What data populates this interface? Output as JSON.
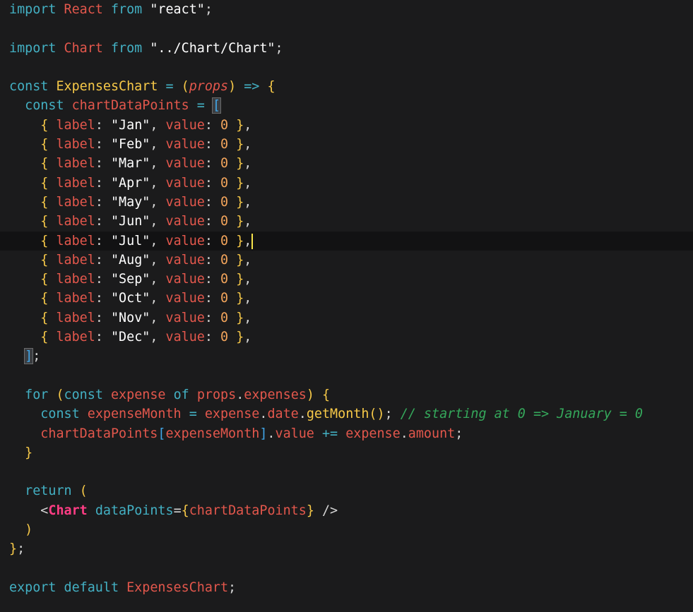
{
  "editor": {
    "lines": [
      {
        "tokens": [
          [
            "kw",
            "import"
          ],
          [
            "punc",
            " "
          ],
          [
            "cls",
            "React"
          ],
          [
            "punc",
            " "
          ],
          [
            "kw",
            "from"
          ],
          [
            "punc",
            " "
          ],
          [
            "str",
            "\"react\""
          ],
          [
            "punc",
            ";"
          ]
        ]
      },
      {
        "tokens": []
      },
      {
        "tokens": [
          [
            "kw",
            "import"
          ],
          [
            "punc",
            " "
          ],
          [
            "cls",
            "Chart"
          ],
          [
            "punc",
            " "
          ],
          [
            "kw",
            "from"
          ],
          [
            "punc",
            " "
          ],
          [
            "str",
            "\"../Chart/Chart\""
          ],
          [
            "punc",
            ";"
          ]
        ]
      },
      {
        "tokens": []
      },
      {
        "tokens": [
          [
            "kw",
            "const"
          ],
          [
            "punc",
            " "
          ],
          [
            "fn",
            "ExpensesChart"
          ],
          [
            "punc",
            " "
          ],
          [
            "op",
            "="
          ],
          [
            "punc",
            " "
          ],
          [
            "paren",
            "("
          ],
          [
            "param",
            "props"
          ],
          [
            "paren",
            ")"
          ],
          [
            "punc",
            " "
          ],
          [
            "op",
            "=>"
          ],
          [
            "punc",
            " "
          ],
          [
            "brace",
            "{"
          ]
        ]
      },
      {
        "tokens": [
          [
            "punc",
            "  "
          ],
          [
            "kw",
            "const"
          ],
          [
            "punc",
            " "
          ],
          [
            "var",
            "chartDataPoints"
          ],
          [
            "punc",
            " "
          ],
          [
            "op",
            "="
          ],
          [
            "punc",
            " "
          ],
          [
            "bracket",
            "["
          ]
        ]
      },
      {
        "tokens": [
          [
            "punc",
            "    "
          ],
          [
            "brace",
            "{"
          ],
          [
            "punc",
            " "
          ],
          [
            "prop",
            "label"
          ],
          [
            "punc",
            ": "
          ],
          [
            "str",
            "\"Jan\""
          ],
          [
            "punc",
            ", "
          ],
          [
            "prop",
            "value"
          ],
          [
            "punc",
            ": "
          ],
          [
            "num",
            "0"
          ],
          [
            "punc",
            " "
          ],
          [
            "brace",
            "}"
          ],
          [
            "punc",
            ","
          ]
        ]
      },
      {
        "tokens": [
          [
            "punc",
            "    "
          ],
          [
            "brace",
            "{"
          ],
          [
            "punc",
            " "
          ],
          [
            "prop",
            "label"
          ],
          [
            "punc",
            ": "
          ],
          [
            "str",
            "\"Feb\""
          ],
          [
            "punc",
            ", "
          ],
          [
            "prop",
            "value"
          ],
          [
            "punc",
            ": "
          ],
          [
            "num",
            "0"
          ],
          [
            "punc",
            " "
          ],
          [
            "brace",
            "}"
          ],
          [
            "punc",
            ","
          ]
        ]
      },
      {
        "tokens": [
          [
            "punc",
            "    "
          ],
          [
            "brace",
            "{"
          ],
          [
            "punc",
            " "
          ],
          [
            "prop",
            "label"
          ],
          [
            "punc",
            ": "
          ],
          [
            "str",
            "\"Mar\""
          ],
          [
            "punc",
            ", "
          ],
          [
            "prop",
            "value"
          ],
          [
            "punc",
            ": "
          ],
          [
            "num",
            "0"
          ],
          [
            "punc",
            " "
          ],
          [
            "brace",
            "}"
          ],
          [
            "punc",
            ","
          ]
        ]
      },
      {
        "tokens": [
          [
            "punc",
            "    "
          ],
          [
            "brace",
            "{"
          ],
          [
            "punc",
            " "
          ],
          [
            "prop",
            "label"
          ],
          [
            "punc",
            ": "
          ],
          [
            "str",
            "\"Apr\""
          ],
          [
            "punc",
            ", "
          ],
          [
            "prop",
            "value"
          ],
          [
            "punc",
            ": "
          ],
          [
            "num",
            "0"
          ],
          [
            "punc",
            " "
          ],
          [
            "brace",
            "}"
          ],
          [
            "punc",
            ","
          ]
        ]
      },
      {
        "tokens": [
          [
            "punc",
            "    "
          ],
          [
            "brace",
            "{"
          ],
          [
            "punc",
            " "
          ],
          [
            "prop",
            "label"
          ],
          [
            "punc",
            ": "
          ],
          [
            "str",
            "\"May\""
          ],
          [
            "punc",
            ", "
          ],
          [
            "prop",
            "value"
          ],
          [
            "punc",
            ": "
          ],
          [
            "num",
            "0"
          ],
          [
            "punc",
            " "
          ],
          [
            "brace",
            "}"
          ],
          [
            "punc",
            ","
          ]
        ]
      },
      {
        "tokens": [
          [
            "punc",
            "    "
          ],
          [
            "brace",
            "{"
          ],
          [
            "punc",
            " "
          ],
          [
            "prop",
            "label"
          ],
          [
            "punc",
            ": "
          ],
          [
            "str",
            "\"Jun\""
          ],
          [
            "punc",
            ", "
          ],
          [
            "prop",
            "value"
          ],
          [
            "punc",
            ": "
          ],
          [
            "num",
            "0"
          ],
          [
            "punc",
            " "
          ],
          [
            "brace",
            "}"
          ],
          [
            "punc",
            ","
          ]
        ]
      },
      {
        "tokens": [
          [
            "punc",
            "    "
          ],
          [
            "brace",
            "{"
          ],
          [
            "punc",
            " "
          ],
          [
            "prop",
            "label"
          ],
          [
            "punc",
            ": "
          ],
          [
            "str",
            "\"Jul\""
          ],
          [
            "punc",
            ", "
          ],
          [
            "prop",
            "value"
          ],
          [
            "punc",
            ": "
          ],
          [
            "num",
            "0"
          ],
          [
            "punc",
            " "
          ],
          [
            "brace",
            "}"
          ],
          [
            "punc",
            ","
          ]
        ],
        "current": true
      },
      {
        "tokens": [
          [
            "punc",
            "    "
          ],
          [
            "brace",
            "{"
          ],
          [
            "punc",
            " "
          ],
          [
            "prop",
            "label"
          ],
          [
            "punc",
            ": "
          ],
          [
            "str",
            "\"Aug\""
          ],
          [
            "punc",
            ", "
          ],
          [
            "prop",
            "value"
          ],
          [
            "punc",
            ": "
          ],
          [
            "num",
            "0"
          ],
          [
            "punc",
            " "
          ],
          [
            "brace",
            "}"
          ],
          [
            "punc",
            ","
          ]
        ]
      },
      {
        "tokens": [
          [
            "punc",
            "    "
          ],
          [
            "brace",
            "{"
          ],
          [
            "punc",
            " "
          ],
          [
            "prop",
            "label"
          ],
          [
            "punc",
            ": "
          ],
          [
            "str",
            "\"Sep\""
          ],
          [
            "punc",
            ", "
          ],
          [
            "prop",
            "value"
          ],
          [
            "punc",
            ": "
          ],
          [
            "num",
            "0"
          ],
          [
            "punc",
            " "
          ],
          [
            "brace",
            "}"
          ],
          [
            "punc",
            ","
          ]
        ]
      },
      {
        "tokens": [
          [
            "punc",
            "    "
          ],
          [
            "brace",
            "{"
          ],
          [
            "punc",
            " "
          ],
          [
            "prop",
            "label"
          ],
          [
            "punc",
            ": "
          ],
          [
            "str",
            "\"Oct\""
          ],
          [
            "punc",
            ", "
          ],
          [
            "prop",
            "value"
          ],
          [
            "punc",
            ": "
          ],
          [
            "num",
            "0"
          ],
          [
            "punc",
            " "
          ],
          [
            "brace",
            "}"
          ],
          [
            "punc",
            ","
          ]
        ]
      },
      {
        "tokens": [
          [
            "punc",
            "    "
          ],
          [
            "brace",
            "{"
          ],
          [
            "punc",
            " "
          ],
          [
            "prop",
            "label"
          ],
          [
            "punc",
            ": "
          ],
          [
            "str",
            "\"Nov\""
          ],
          [
            "punc",
            ", "
          ],
          [
            "prop",
            "value"
          ],
          [
            "punc",
            ": "
          ],
          [
            "num",
            "0"
          ],
          [
            "punc",
            " "
          ],
          [
            "brace",
            "}"
          ],
          [
            "punc",
            ","
          ]
        ]
      },
      {
        "tokens": [
          [
            "punc",
            "    "
          ],
          [
            "brace",
            "{"
          ],
          [
            "punc",
            " "
          ],
          [
            "prop",
            "label"
          ],
          [
            "punc",
            ": "
          ],
          [
            "str",
            "\"Dec\""
          ],
          [
            "punc",
            ", "
          ],
          [
            "prop",
            "value"
          ],
          [
            "punc",
            ": "
          ],
          [
            "num",
            "0"
          ],
          [
            "punc",
            " "
          ],
          [
            "brace",
            "}"
          ],
          [
            "punc",
            ","
          ]
        ]
      },
      {
        "tokens": [
          [
            "punc",
            "  "
          ],
          [
            "bracket",
            "]"
          ],
          [
            "punc",
            ";"
          ]
        ]
      },
      {
        "tokens": []
      },
      {
        "tokens": [
          [
            "punc",
            "  "
          ],
          [
            "kw",
            "for"
          ],
          [
            "punc",
            " "
          ],
          [
            "paren",
            "("
          ],
          [
            "kw",
            "const"
          ],
          [
            "punc",
            " "
          ],
          [
            "var",
            "expense"
          ],
          [
            "punc",
            " "
          ],
          [
            "kw",
            "of"
          ],
          [
            "punc",
            " "
          ],
          [
            "var",
            "props"
          ],
          [
            "punc",
            "."
          ],
          [
            "var",
            "expenses"
          ],
          [
            "paren",
            ")"
          ],
          [
            "punc",
            " "
          ],
          [
            "brace",
            "{"
          ]
        ]
      },
      {
        "tokens": [
          [
            "punc",
            "    "
          ],
          [
            "kw",
            "const"
          ],
          [
            "punc",
            " "
          ],
          [
            "var",
            "expenseMonth"
          ],
          [
            "punc",
            " "
          ],
          [
            "op",
            "="
          ],
          [
            "punc",
            " "
          ],
          [
            "var",
            "expense"
          ],
          [
            "punc",
            "."
          ],
          [
            "var",
            "date"
          ],
          [
            "punc",
            "."
          ],
          [
            "fn",
            "getMonth"
          ],
          [
            "paren",
            "()"
          ],
          [
            "punc",
            "; "
          ],
          [
            "cmt",
            "// starting at 0 => January = 0"
          ]
        ]
      },
      {
        "tokens": [
          [
            "punc",
            "    "
          ],
          [
            "var",
            "chartDataPoints"
          ],
          [
            "bracket",
            "["
          ],
          [
            "var",
            "expenseMonth"
          ],
          [
            "bracket",
            "]"
          ],
          [
            "punc",
            "."
          ],
          [
            "var",
            "value"
          ],
          [
            "punc",
            " "
          ],
          [
            "op",
            "+="
          ],
          [
            "punc",
            " "
          ],
          [
            "var",
            "expense"
          ],
          [
            "punc",
            "."
          ],
          [
            "var",
            "amount"
          ],
          [
            "punc",
            ";"
          ]
        ]
      },
      {
        "tokens": [
          [
            "punc",
            "  "
          ],
          [
            "brace",
            "}"
          ]
        ]
      },
      {
        "tokens": []
      },
      {
        "tokens": [
          [
            "punc",
            "  "
          ],
          [
            "kw",
            "return"
          ],
          [
            "punc",
            " "
          ],
          [
            "paren",
            "("
          ]
        ]
      },
      {
        "tokens": [
          [
            "punc",
            "    "
          ],
          [
            "punc",
            "<"
          ],
          [
            "tag",
            "Chart"
          ],
          [
            "punc",
            " "
          ],
          [
            "attr",
            "dataPoints"
          ],
          [
            "punc",
            "="
          ],
          [
            "brace",
            "{"
          ],
          [
            "var",
            "chartDataPoints"
          ],
          [
            "brace",
            "}"
          ],
          [
            "punc",
            " />"
          ]
        ]
      },
      {
        "tokens": [
          [
            "punc",
            "  "
          ],
          [
            "paren",
            ")"
          ]
        ]
      },
      {
        "tokens": [
          [
            "brace",
            "}"
          ],
          [
            "punc",
            ";"
          ]
        ]
      },
      {
        "tokens": []
      },
      {
        "tokens": [
          [
            "kw",
            "export"
          ],
          [
            "punc",
            " "
          ],
          [
            "kw",
            "default"
          ],
          [
            "punc",
            " "
          ],
          [
            "cls",
            "ExpensesChart"
          ],
          [
            "punc",
            ";"
          ]
        ]
      }
    ],
    "colors": {
      "background": "#1b1b1c",
      "current_line": "#121213",
      "keyword": "#43b0c3",
      "identifier": "#e3574c",
      "string": "#ffffff",
      "number": "#f2a45b",
      "brace": "#f7c948",
      "bracket": "#41a6e8",
      "comment": "#35a85b",
      "jsx_tag": "#ff3d84",
      "caret": "#f7e34a"
    }
  }
}
